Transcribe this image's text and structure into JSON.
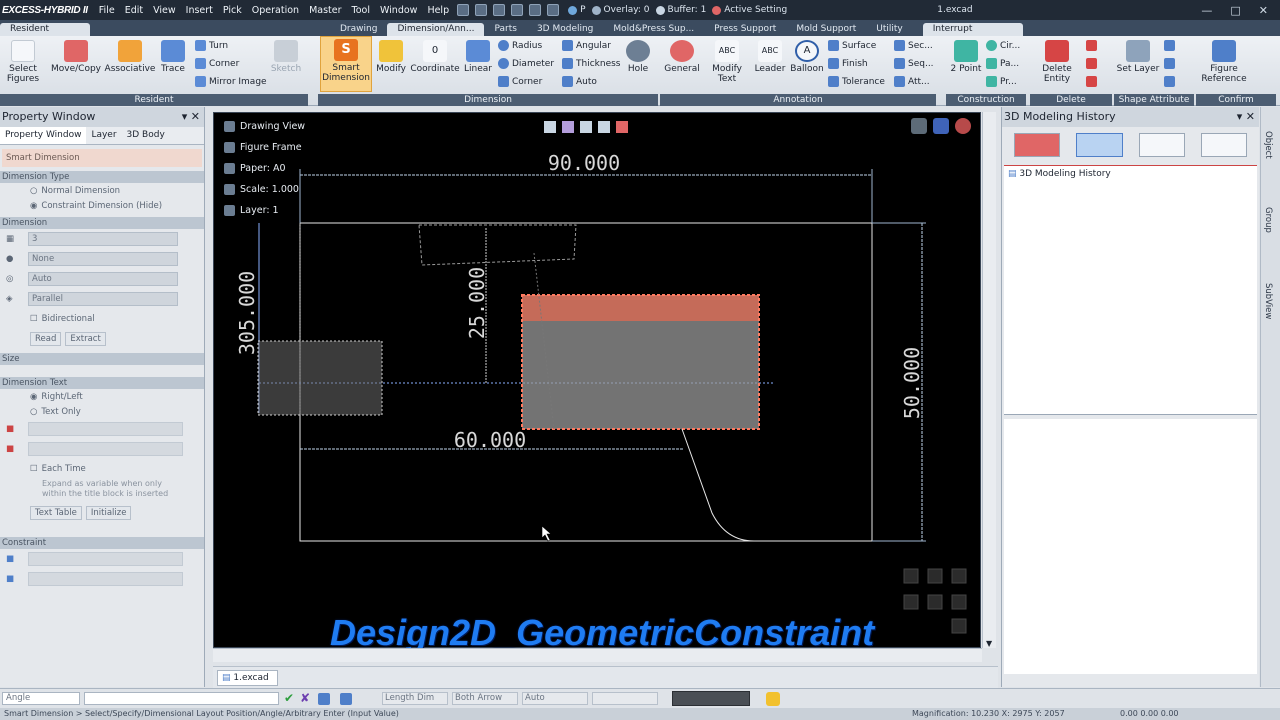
{
  "title_bar": {
    "app": "EXCESS-HYBRID II",
    "menus": [
      "File",
      "Edit",
      "View",
      "Insert",
      "Pick",
      "Operation",
      "Master",
      "Tool",
      "Window",
      "Help"
    ],
    "overlay": "Overlay: 0",
    "buffer": "Buffer: 1",
    "active_setting": "Active Setting",
    "file": "1.excad",
    "p_label": "P"
  },
  "ribbon_tabs": [
    "Resident",
    "Drawing",
    "Dimension/Ann...",
    "Parts",
    "3D Modeling",
    "Mold&Press Sup...",
    "Press Support",
    "Mold Support",
    "Utility",
    "Interrupt"
  ],
  "ribbon": {
    "select_figures": "Select Figures",
    "move_copy": "Move/Copy",
    "associative": "Associative",
    "trace": "Trace",
    "turn": "Turn",
    "corner": "Corner",
    "mirror_image": "Mirror Image",
    "sketch": "Sketch",
    "smart_dimension": "Smart Dimension",
    "modify": "Modify",
    "coordinate": "Coordinate",
    "coordinate_value": "0",
    "linear": "Linear",
    "radius": "Radius",
    "diameter": "Diameter",
    "corner2": "Corner",
    "angular": "Angular",
    "thickness": "Thickness",
    "auto": "Auto",
    "hole": "Hole",
    "general": "General",
    "modify_text": "Modify Text",
    "leader": "Leader",
    "balloon": "Balloon",
    "surface": "Surface",
    "finish": "Finish",
    "tolerance": "Tolerance",
    "sec": "Sec...",
    "seq": "Seq...",
    "att": "Att...",
    "two_point": "2 Point",
    "cir": "Cir...",
    "pa": "Pa...",
    "pr": "Pr...",
    "delete_entity": "Delete Entity",
    "set_layer": "Set Layer",
    "figure_reference": "Figure Reference",
    "groups": [
      "Resident",
      "Dimension",
      "Annotation",
      "Construction",
      "Delete",
      "Shape Attribute",
      "Confirm"
    ]
  },
  "property_window": {
    "title": "Property Window",
    "tabs": [
      "Property Window",
      "Layer",
      "3D Body"
    ],
    "command": "Smart Dimension",
    "dimension_type": "Dimension Type",
    "normal": "Normal Dimension",
    "constraint": "Constraint Dimension (Hide)",
    "dimension": "Dimension",
    "val1": "3",
    "val2": "None",
    "val3": "Auto",
    "val4": "Parallel",
    "bidirectional": "Bidirectional",
    "read": "Read",
    "extract": "Extract",
    "size": "Size",
    "dimension_text": "Dimension Text",
    "right_left": "Right/Left",
    "text_only": "Text Only",
    "each_time": "Each Time",
    "note": "Expand as variable when only within the title block is inserted",
    "text_table": "Text Table",
    "initialize": "Initialize",
    "constraint_sec": "Constraint"
  },
  "canvas": {
    "drawing_view": "Drawing View",
    "figure_frame": "Figure Frame",
    "paper": "Paper: A0",
    "scale": "Scale: 1.000",
    "layer": "Layer: 1",
    "dim_90": "90.000",
    "dim_60": "60.000",
    "dim_50": "50.000",
    "dim_25": "25.000",
    "dim_305": "305.000"
  },
  "caption": "Design2D_GeometricConstraint",
  "history": {
    "title": "3D Modeling History",
    "tree_root": "3D Modeling History"
  },
  "side_tabs": [
    "Object",
    "Group",
    "SubView"
  ],
  "doc_tab": "1.excad",
  "status_inputs": {
    "angle": "Angle",
    "length_dim": "Length Dim",
    "both_arrow": "Both Arrow",
    "auto": "Auto"
  },
  "status_text": "Smart Dimension > Select/Specify/Dimensional Layout Position/Angle/Arbitrary Enter (Input Value)",
  "magnification": "Magnification: 10.230  X: 2975  Y: 2057",
  "coords_right": "0.00   0.00   0.00"
}
